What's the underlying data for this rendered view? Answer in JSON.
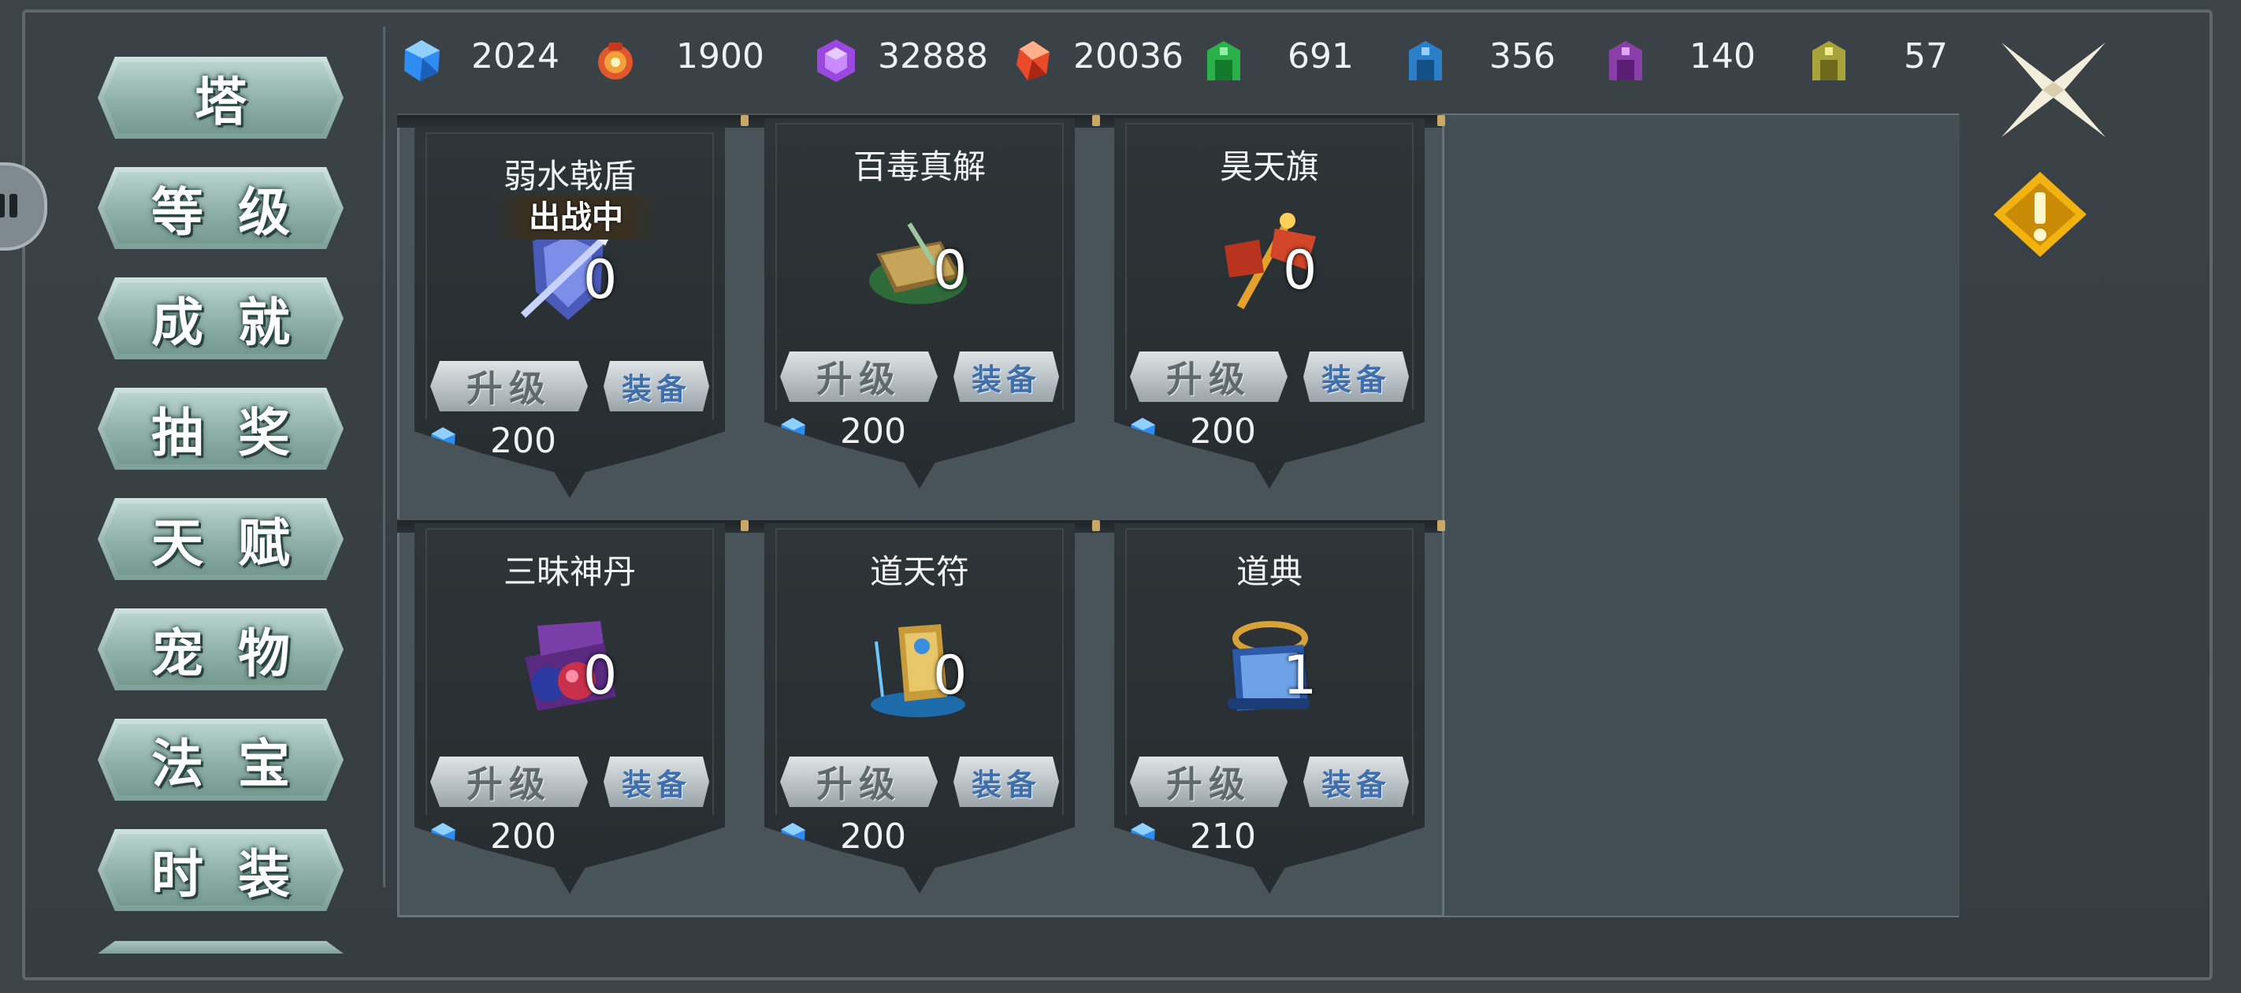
{
  "currencies": [
    {
      "icon": "blue-gem-icon",
      "value": "2024"
    },
    {
      "icon": "red-pouch-icon",
      "value": "1900"
    },
    {
      "icon": "purple-gem-icon",
      "value": "32888"
    },
    {
      "icon": "red-gem-icon",
      "value": "20036"
    },
    {
      "icon": "green-key-icon",
      "value": "691"
    },
    {
      "icon": "blue-key-icon",
      "value": "356"
    },
    {
      "icon": "purple-key-icon",
      "value": "140"
    },
    {
      "icon": "yellow-key-icon",
      "value": "57"
    }
  ],
  "side_menu": [
    {
      "id": "tower",
      "label": "塔"
    },
    {
      "id": "level",
      "label": "等级"
    },
    {
      "id": "achievement",
      "label": "成就"
    },
    {
      "id": "lottery",
      "label": "抽奖"
    },
    {
      "id": "talent",
      "label": "天赋"
    },
    {
      "id": "pet",
      "label": "宠物"
    },
    {
      "id": "treasure",
      "label": "法宝"
    },
    {
      "id": "fashion",
      "label": "时装"
    }
  ],
  "cards": [
    {
      "name": "弱水戟盾",
      "badge": "出战中",
      "count": "0",
      "upgrade": "升级",
      "equip": "装备",
      "cost": "200",
      "icon": "halberd-shield-icon"
    },
    {
      "name": "百毒真解",
      "badge": "",
      "count": "0",
      "upgrade": "升级",
      "equip": "装备",
      "cost": "200",
      "icon": "poison-book-icon"
    },
    {
      "name": "昊天旗",
      "badge": "",
      "count": "0",
      "upgrade": "升级",
      "equip": "装备",
      "cost": "200",
      "icon": "sky-flag-icon"
    },
    {
      "name": "三昧神丹",
      "badge": "",
      "count": "0",
      "upgrade": "升级",
      "equip": "装备",
      "cost": "200",
      "icon": "pill-box-icon"
    },
    {
      "name": "道天符",
      "badge": "",
      "count": "0",
      "upgrade": "升级",
      "equip": "装备",
      "cost": "200",
      "icon": "talisman-icon"
    },
    {
      "name": "道典",
      "badge": "",
      "count": "1",
      "upgrade": "升级",
      "equip": "装备",
      "cost": "210",
      "icon": "scripture-scroll-icon"
    }
  ],
  "colors": {
    "accent_gold": "#f2b20f",
    "menu_teal": "#9fbcb6",
    "cost_blue": "#3fa8ff"
  }
}
